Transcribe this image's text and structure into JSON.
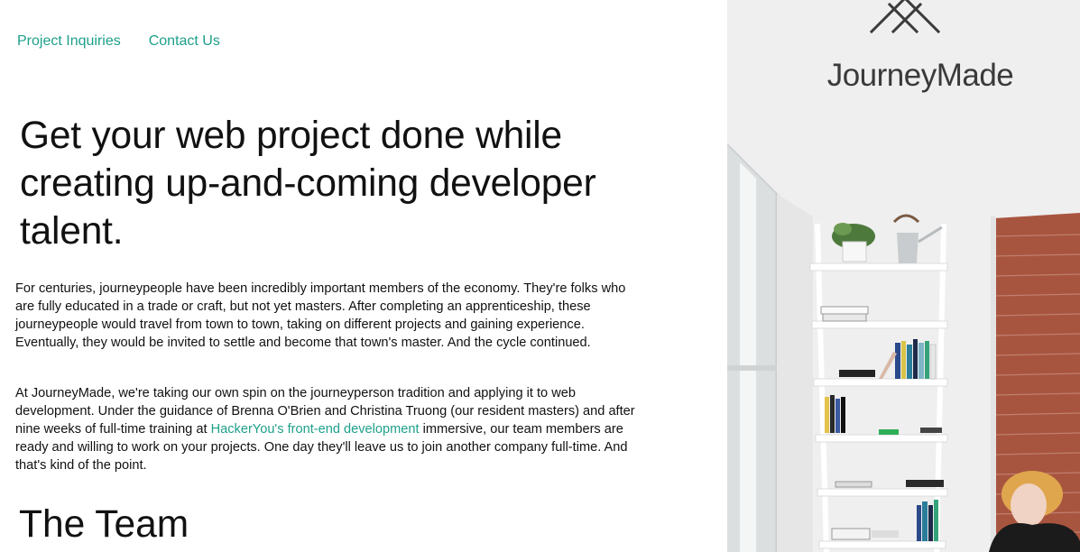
{
  "nav": {
    "items": [
      {
        "label": "Project Inquiries"
      },
      {
        "label": "Contact Us"
      }
    ]
  },
  "hero": {
    "headline": "Get your web project done while creating up-and-coming developer talent."
  },
  "intro": {
    "paragraph1": "For centuries, journeypeople have been incredibly important members of the economy. They're folks who are fully educated in a trade or craft, but not yet masters. After completing an apprenticeship, these journeypeople would travel from town to town, taking on different projects and gaining experience. Eventually, they would be invited to settle and become that town's master. And the cycle continued.",
    "paragraph2_before": "At JourneyMade, we're taking our own spin on the journeyperson tradition and applying it to web development. Under the guidance of Brenna O'Brien and Christina Truong (our resident masters) and after nine weeks of full-time training at ",
    "paragraph2_link": "HackerYou's front-end development",
    "paragraph2_after": " immersive, our team members are ready and willing to work on your projects. One day they'll leave us to join another company full-time. And that's kind of the point."
  },
  "team": {
    "heading": "The Team"
  },
  "brand": {
    "name": "JourneyMade",
    "logo_icon": "mountain-peaks-icon"
  },
  "colors": {
    "accent": "#1ea08a",
    "text": "#111111",
    "brand_text": "#3a3a3a"
  }
}
